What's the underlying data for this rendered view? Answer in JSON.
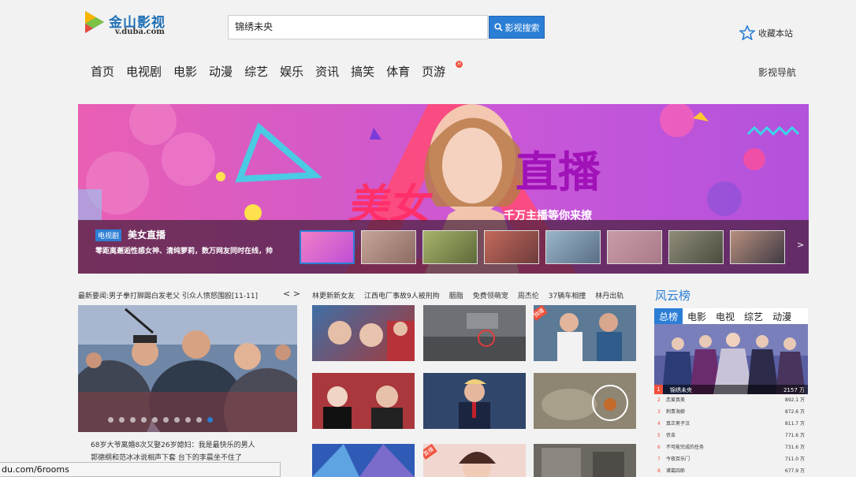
{
  "header": {
    "logo_text": "金山影视",
    "logo_domain": "v.duba.com",
    "search_value": "锦绣未央",
    "search_button": "影视搜索",
    "favorite": "收藏本站"
  },
  "nav": {
    "items": [
      "首页",
      "电视剧",
      "电影",
      "动漫",
      "综艺",
      "娱乐",
      "资讯",
      "搞笑",
      "体育",
      "页游"
    ],
    "hot_badge": "H",
    "guide": "影视导航"
  },
  "banner": {
    "tag": "电视剧",
    "title": "美女直播",
    "description": "零距离邂逅性感女神、清纯萝莉，数万网友同时在线，帅",
    "art_text_1": "美女",
    "art_text_2": "直播",
    "art_text_3": "千万主播等你来撩",
    "next": ">"
  },
  "news": {
    "headline": "最新要闻:男子拳打脚踢白发老父 引众人愤怒围殴[11-11]",
    "prev": "<",
    "next": ">",
    "caption_1": "68岁大爷离婚8次又娶26岁媳妇：我是最快乐的男人",
    "caption_2": "郭德纲和范冰冰说相声下套 台下的李晨坐不住了"
  },
  "statusbar": "du.com/6rooms",
  "tags": [
    "林更新新女友",
    "江西电厂事故9人被刑拘",
    "胭脂",
    "免费领萌宠",
    "周杰伦",
    "37辆车相撞",
    "林丹出轨"
  ],
  "tile_labels": [
    "独播",
    "直播"
  ],
  "rank": {
    "title": "风云榜",
    "tabs": [
      "总榜",
      "电影",
      "电视",
      "综艺",
      "动漫"
    ],
    "top": {
      "num": "1",
      "title": "锦绣未央",
      "value": "2157 万"
    },
    "rows": [
      {
        "num": "2",
        "title": "恋爱真美",
        "value": "892.1 万"
      },
      {
        "num": "3",
        "title": "刺青海娘",
        "value": "872.6 万"
      },
      {
        "num": "4",
        "title": "真正男子汉",
        "value": "811.7 万"
      },
      {
        "num": "5",
        "title": "伏击",
        "value": "771.6 万"
      },
      {
        "num": "6",
        "title": "不可能完成的任务",
        "value": "731.6 万"
      },
      {
        "num": "7",
        "title": "今夜百乐门",
        "value": "711.0 万"
      },
      {
        "num": "8",
        "title": "诸葛四郎",
        "value": "677.9 万"
      }
    ]
  },
  "colors": {
    "accent": "#2b7ed5",
    "hot": "#f0503c",
    "banner_pink": "#e95fb4"
  }
}
